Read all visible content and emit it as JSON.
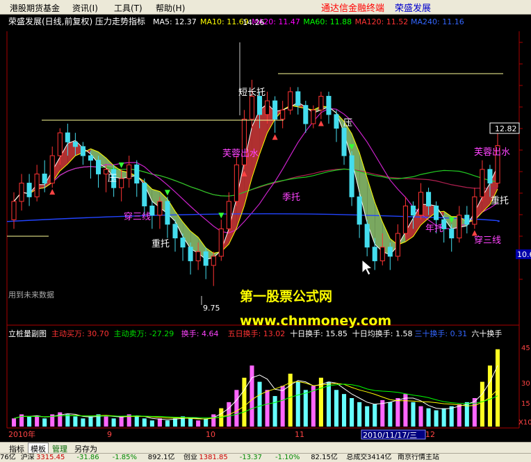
{
  "menu": {
    "items": [
      "港股期货基金",
      "资讯(I)",
      "工具(T)",
      "帮助(H)"
    ],
    "brand_left": "通达信金融终端",
    "brand_right": "荣盛发展"
  },
  "main_panel": {
    "title": "荣盛发展(日线,前复权) 压力走势指标",
    "ma_legend": [
      {
        "label": "MA5: 12.37",
        "color": "#ffffff"
      },
      {
        "label": "MA10: 11.69",
        "color": "#ffff00"
      },
      {
        "label": "MA20: 11.47",
        "color": "#ff00ff"
      },
      {
        "label": "MA60: 11.88",
        "color": "#00ff00"
      },
      {
        "label": "MA120: 11.52",
        "color": "#ff3333"
      },
      {
        "label": "MA240: 11.16",
        "color": "#3366ff"
      }
    ],
    "high_label": "14.26",
    "low_label": "9.75",
    "last_price": "12.82",
    "side_value": "10.6",
    "future_data_note": "用到未来数据",
    "annotations": [
      {
        "text": "压",
        "color": "#ffffff"
      },
      {
        "text": "穿三线",
        "color": "#ff44ff"
      },
      {
        "text": "重托",
        "color": "#ffffff"
      },
      {
        "text": "短长托",
        "color": "#ffffff"
      },
      {
        "text": "芙蓉出水",
        "color": "#ff44ff"
      },
      {
        "text": "季托",
        "color": "#ff44ff"
      },
      {
        "text": "压",
        "color": "#ffffff"
      },
      {
        "text": "年托",
        "color": "#ff44ff"
      },
      {
        "text": "芙蓉出水",
        "color": "#ff44ff"
      },
      {
        "text": "重托",
        "color": "#ffffff"
      },
      {
        "text": "穿三线",
        "color": "#ff44ff"
      }
    ]
  },
  "watermark": {
    "line1": "第一股票公式网",
    "line2": "www.chnmoney.com"
  },
  "sub_panel": {
    "title": "立桩量副图",
    "legend": [
      {
        "label": "主动买万: 30.70",
        "color": "#ff3333"
      },
      {
        "label": "主动卖万: -27.29",
        "color": "#00dd00"
      },
      {
        "label": "换手: 4.64",
        "color": "#ff44ff"
      },
      {
        "label": "五日换手: 13.02",
        "color": "#ff3333"
      },
      {
        "label": "十日换手: 15.85",
        "color": "#ffffff"
      },
      {
        "label": "十日均换手: 1.58",
        "color": "#ffffff"
      },
      {
        "label": "三十换手: 0.31",
        "color": "#3366ff"
      },
      {
        "label": "六十换手",
        "color": "#ffffff"
      }
    ],
    "axis_labels": [
      "45",
      "30",
      "15",
      "X10"
    ]
  },
  "time_axis": {
    "labels": [
      "2010年",
      "9",
      "10",
      "11",
      "12"
    ],
    "cursor_date": "2010/11/17/三"
  },
  "tabs": [
    "指标",
    "模板",
    "管理",
    "另存为"
  ],
  "status": [
    {
      "text": "76亿",
      "color": "#000000"
    },
    {
      "text": "沪深",
      "color": "#000000"
    },
    {
      "text": "3315.45",
      "color": "#cc0000"
    },
    {
      "text": "-31.86",
      "color": "#008800"
    },
    {
      "text": "-1.85%",
      "color": "#008800"
    },
    {
      "text": "892.1亿",
      "color": "#000000"
    },
    {
      "text": "创业",
      "color": "#000000"
    },
    {
      "text": "1381.85",
      "color": "#cc0000"
    },
    {
      "text": "-13.37",
      "color": "#008800"
    },
    {
      "text": "-1.10%",
      "color": "#008800"
    },
    {
      "text": "82.15亿",
      "color": "#000000"
    },
    {
      "text": "总成交",
      "color": "#000000"
    },
    {
      "text": "3414亿",
      "color": "#000000"
    },
    {
      "text": "南京行情主站",
      "color": "#000000"
    }
  ],
  "chart_data": {
    "type": "candlestick",
    "ylim": [
      9.0,
      15.2
    ],
    "y_high": 14.26,
    "y_low": 9.75,
    "last": 12.82,
    "candles": [
      [
        11.2,
        11.6,
        11.0,
        11.8
      ],
      [
        11.6,
        12.0,
        11.4,
        12.2
      ],
      [
        12.0,
        11.7,
        11.5,
        12.2
      ],
      [
        11.7,
        12.2,
        11.6,
        12.4
      ],
      [
        12.2,
        12.0,
        11.8,
        12.5
      ],
      [
        12.0,
        12.6,
        11.9,
        12.8
      ],
      [
        12.6,
        13.1,
        12.4,
        13.2
      ],
      [
        13.1,
        12.9,
        12.6,
        13.3
      ],
      [
        12.9,
        12.8,
        12.6,
        13.1
      ],
      [
        12.8,
        12.6,
        12.4,
        12.9
      ],
      [
        12.6,
        12.5,
        12.1,
        12.7
      ],
      [
        12.5,
        12.2,
        11.9,
        12.6
      ],
      [
        12.2,
        12.3,
        11.8,
        12.4
      ],
      [
        12.3,
        11.9,
        11.7,
        12.4
      ],
      [
        11.9,
        12.1,
        11.6,
        12.3
      ],
      [
        12.1,
        12.4,
        11.9,
        12.6
      ],
      [
        12.4,
        12.0,
        11.7,
        12.5
      ],
      [
        12.0,
        11.5,
        11.3,
        12.1
      ],
      [
        11.5,
        11.3,
        11.0,
        11.6
      ],
      [
        11.3,
        11.6,
        11.0,
        11.7
      ],
      [
        11.6,
        11.1,
        10.8,
        11.7
      ],
      [
        11.1,
        10.8,
        10.5,
        11.2
      ],
      [
        10.8,
        10.6,
        10.3,
        10.9
      ],
      [
        10.6,
        10.3,
        10.0,
        10.7
      ],
      [
        10.3,
        10.5,
        10.1,
        10.7
      ],
      [
        10.5,
        10.2,
        9.9,
        10.6
      ],
      [
        10.2,
        10.4,
        9.75,
        10.5
      ],
      [
        10.4,
        11.0,
        10.3,
        11.2
      ],
      [
        11.0,
        11.6,
        10.9,
        11.8
      ],
      [
        11.6,
        12.4,
        11.5,
        12.6
      ],
      [
        12.4,
        13.4,
        12.3,
        13.6
      ],
      [
        13.4,
        13.9,
        13.2,
        14.26
      ],
      [
        13.9,
        13.5,
        13.2,
        14.0
      ],
      [
        13.5,
        13.8,
        13.3,
        14.0
      ],
      [
        13.8,
        13.4,
        13.1,
        13.9
      ],
      [
        13.4,
        13.6,
        13.2,
        13.8
      ],
      [
        13.6,
        14.0,
        13.5,
        14.1
      ],
      [
        14.0,
        13.7,
        13.5,
        14.1
      ],
      [
        13.7,
        13.3,
        13.1,
        13.8
      ],
      [
        13.3,
        13.6,
        13.2,
        13.7
      ],
      [
        13.6,
        13.9,
        13.4,
        14.0
      ],
      [
        13.9,
        13.5,
        13.3,
        14.0
      ],
      [
        13.5,
        13.2,
        12.9,
        13.6
      ],
      [
        13.2,
        12.6,
        12.4,
        13.3
      ],
      [
        12.6,
        11.7,
        11.5,
        12.7
      ],
      [
        11.7,
        11.1,
        10.8,
        11.8
      ],
      [
        11.1,
        10.6,
        10.4,
        11.2
      ],
      [
        10.6,
        10.3,
        10.1,
        10.8
      ],
      [
        10.3,
        10.6,
        10.2,
        10.9
      ],
      [
        10.6,
        10.4,
        10.1,
        10.7
      ],
      [
        10.4,
        10.9,
        10.3,
        11.1
      ],
      [
        10.9,
        11.5,
        10.8,
        11.7
      ],
      [
        11.5,
        11.3,
        11.0,
        11.6
      ],
      [
        11.3,
        11.8,
        11.2,
        12.0
      ],
      [
        11.8,
        11.5,
        11.3,
        11.9
      ],
      [
        11.5,
        11.2,
        10.9,
        11.6
      ],
      [
        11.2,
        11.0,
        10.7,
        11.3
      ],
      [
        11.0,
        10.8,
        10.5,
        11.1
      ],
      [
        10.8,
        11.3,
        10.7,
        11.5
      ],
      [
        11.3,
        11.1,
        10.9,
        11.5
      ],
      [
        11.1,
        11.7,
        11.0,
        11.9
      ],
      [
        11.7,
        12.3,
        11.6,
        12.5
      ],
      [
        12.3,
        12.0,
        11.7,
        12.4
      ],
      [
        12.0,
        12.82,
        11.9,
        13.3
      ]
    ],
    "volumes": [
      4,
      6,
      5,
      5,
      4,
      6,
      7,
      6,
      5,
      4,
      5,
      6,
      5,
      4,
      5,
      6,
      5,
      4,
      3,
      4,
      3,
      4,
      5,
      4,
      3,
      4,
      6,
      9,
      12,
      18,
      24,
      30,
      22,
      18,
      15,
      20,
      26,
      22,
      18,
      20,
      24,
      22,
      18,
      16,
      14,
      12,
      10,
      11,
      13,
      12,
      14,
      16,
      12,
      10,
      9,
      8,
      9,
      10,
      11,
      12,
      14,
      22,
      30,
      38
    ],
    "highlight_volume_idx": [
      27,
      30,
      36,
      40,
      61,
      62,
      63
    ]
  }
}
